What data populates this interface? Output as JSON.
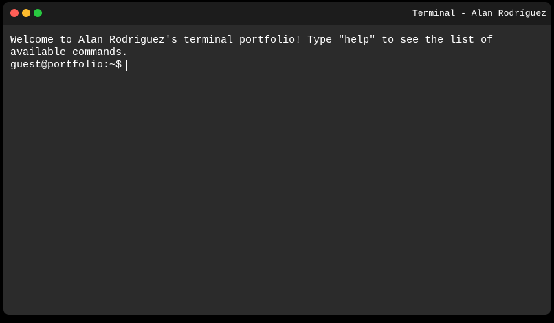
{
  "window": {
    "title": "Terminal - Alan Rodríguez"
  },
  "terminal": {
    "welcome_lines": [
      "Welcome to Alan Rodriguez's terminal portfolio! Type \"help\" to see the list of",
      "available commands."
    ],
    "prompt": "guest@portfolio:~$",
    "input_value": ""
  },
  "icons": {
    "close": "close-traffic-light-icon",
    "minimize": "minimize-traffic-light-icon",
    "maximize": "maximize-traffic-light-icon"
  },
  "colors": {
    "background": "#000000",
    "window": "#2b2b2b",
    "titlebar": "#1c1c1c",
    "text": "#ffffff",
    "close": "#ff5f57",
    "minimize": "#febc2e",
    "maximize": "#28c840"
  }
}
